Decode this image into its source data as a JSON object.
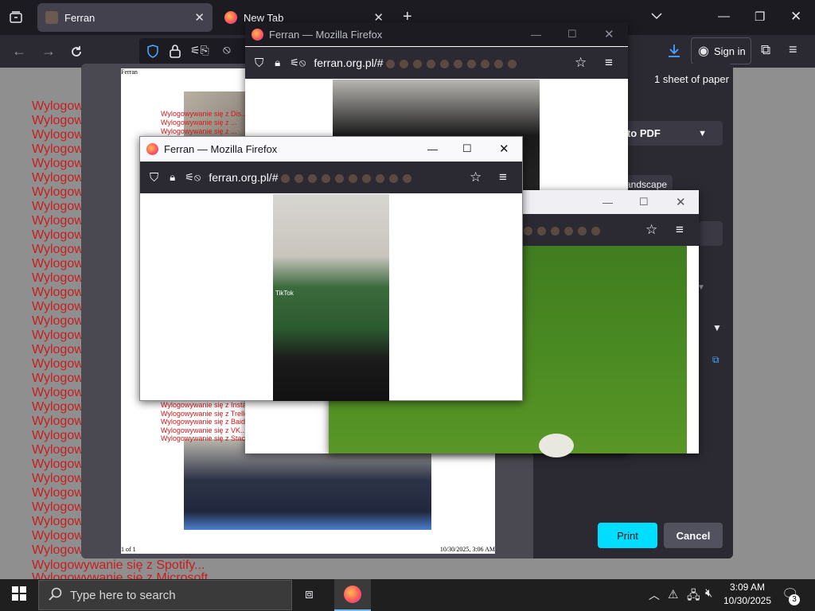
{
  "browser": {
    "tabs": [
      {
        "label": "Ferran",
        "active": true
      },
      {
        "label": "New Tab",
        "active": false
      }
    ],
    "new_tab_symbol": "+",
    "sign_in": "Sign in"
  },
  "background_page": {
    "lines": [
      "Wylogow",
      "Wylogow",
      "Wylogow",
      "Wylogow",
      "Wylogow",
      "Wylogow",
      "Wylogow",
      "Wylogow",
      "Wylogow",
      "Wylogow",
      "Wylogow",
      "Wylogow",
      "Wylogow",
      "Wylogow",
      "Wylogow",
      "Wylogow",
      "Wylogow",
      "Wylogow",
      "Wylogow",
      "Wylogow",
      "Wylogow",
      "Wylogow",
      "Wylogow",
      "Wylogow",
      "Wylogow",
      "Wylogow",
      "Wylogow",
      "Wylogow",
      "Wylogow",
      "Wylogow",
      "Wylogow",
      "Wylogow"
    ],
    "bottom_line_1": "Wylogowywanie się z Spotify...",
    "bottom_line_2": "Wylogowywanie się z Microsoft..."
  },
  "print_dialog": {
    "sheets": "1 sheet of paper",
    "destination": "t to PDF",
    "orientation": "andscape",
    "print_label": "Print",
    "cancel_label": "Cancel",
    "preview": {
      "header": "Ferran",
      "page_count": "1 of 1",
      "date": "10/30/2025, 3:06 AM",
      "red_lines_top": [
        "Wylogowywanie się z Dis...",
        "Wylogowywanie się z ...",
        "Wylogowywanie się z ..."
      ],
      "red_lines_bottom": [
        "Wylogowywanie się z Instagram...",
        "Wylogowywanie się z Trello...",
        "Wylogowywanie się z Baidu...",
        "Wylogowywanie się z VK...",
        "Wylogowywanie się z StackOverflow..."
      ]
    }
  },
  "popup_top": {
    "title": "Ferran — Mozilla Firefox",
    "url": "ferran.org.pl/#"
  },
  "popup_front": {
    "title": "Ferran — Mozilla Firefox",
    "url": "ferran.org.pl/#",
    "video_overlay_text": "TikTok"
  },
  "popup_right": {
    "title": "",
    "url": ""
  },
  "taskbar": {
    "search_placeholder": "Type here to search",
    "time": "3:09 AM",
    "date": "10/30/2025",
    "notification_count": "3"
  },
  "colors": {
    "firefox_chrome": "#2b2a33",
    "print_accent": "#00ddff",
    "spam_red": "#c81d1d"
  }
}
